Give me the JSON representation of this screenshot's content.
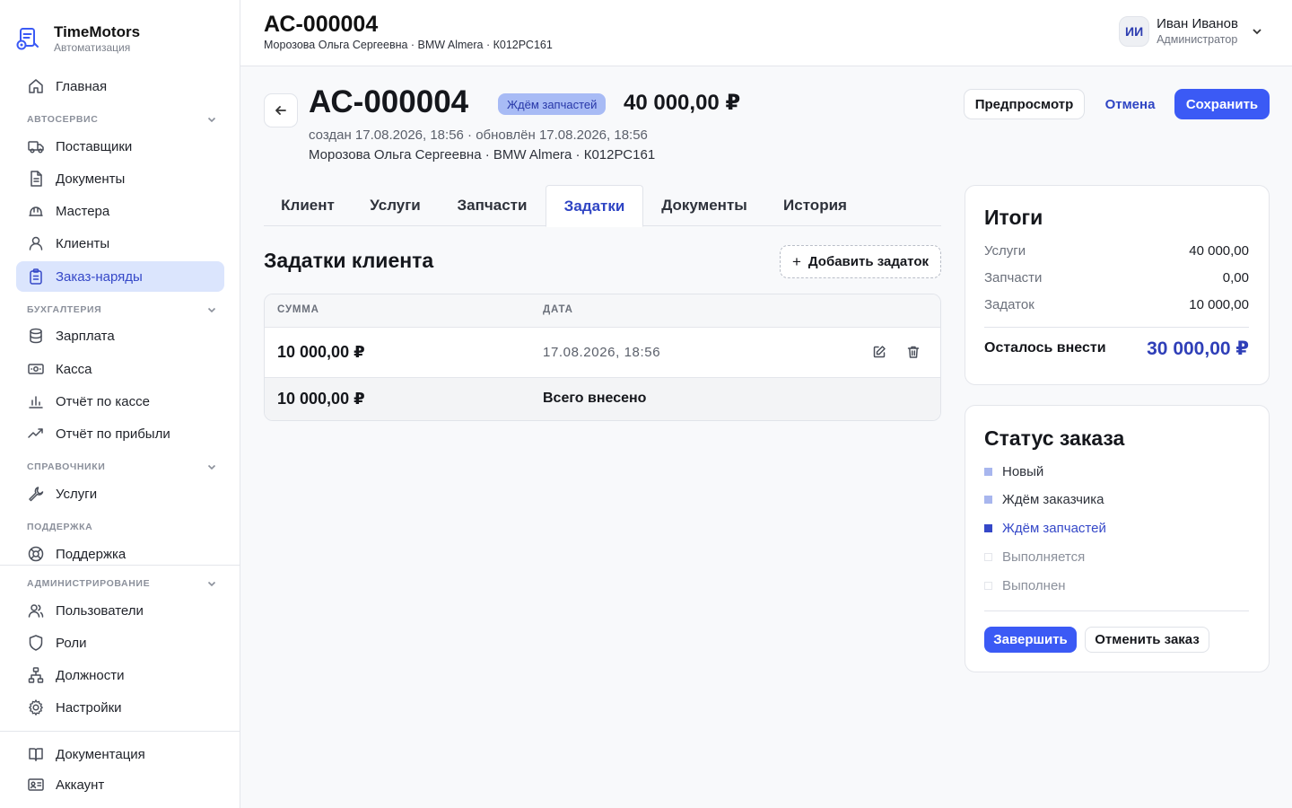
{
  "brand": {
    "name": "TimeMotors",
    "subtitle": "Автоматизация"
  },
  "sidebar": {
    "home": "Главная",
    "sections": {
      "autoservice": "АВТОСЕРВИС",
      "accounting": "БУХГАЛТЕРИЯ",
      "references": "СПРАВОЧНИКИ",
      "support": "ПОДДЕРЖКА",
      "administration": "АДМИНИСТРИРОВАНИЕ"
    },
    "items": {
      "suppliers": "Поставщики",
      "documents": "Документы",
      "masters": "Мастера",
      "clients": "Клиенты",
      "orders": "Заказ-наряды",
      "salary": "Зарплата",
      "cashbox": "Касса",
      "cash_report": "Отчёт по кассе",
      "profit_report": "Отчёт по прибыли",
      "services": "Услуги",
      "support": "Поддержка",
      "users": "Пользователи",
      "roles": "Роли",
      "positions": "Должности",
      "settings": "Настройки",
      "documentation": "Документация",
      "account": "Аккаунт"
    }
  },
  "header": {
    "title": "АС-000004",
    "subtitle": "Морозова Ольга Сергеевна · BMW Almera · К012РС161",
    "user": {
      "initials": "ИИ",
      "name": "Иван Иванов",
      "role": "Администратор"
    }
  },
  "order": {
    "number": "АС-000004",
    "status": "Ждём запчастей",
    "total": "40 000,00 ₽",
    "meta": "создан 17.08.2026, 18:56 · обновлён 17.08.2026, 18:56",
    "client_line": "Морозова Ольга Сергеевна · BMW Almera · К012РС161"
  },
  "actions": {
    "preview": "Предпросмотр",
    "cancel": "Отмена",
    "save": "Сохранить"
  },
  "tabs": [
    "Клиент",
    "Услуги",
    "Запчасти",
    "Задатки",
    "Документы",
    "История"
  ],
  "deposits": {
    "title": "Задатки клиента",
    "add_button": "Добавить задаток",
    "columns": [
      "СУММА",
      "ДАТА"
    ],
    "rows": [
      {
        "amount": "10 000,00 ₽",
        "date": "17.08.2026, 18:56"
      }
    ],
    "footer": {
      "amount": "10 000,00 ₽",
      "label": "Всего внесено"
    }
  },
  "summary": {
    "title": "Итоги",
    "rows": [
      {
        "label": "Услуги",
        "value": "40 000,00"
      },
      {
        "label": "Запчасти",
        "value": "0,00"
      },
      {
        "label": "Задаток",
        "value": "10 000,00"
      }
    ],
    "remaining_label": "Осталось внести",
    "remaining_value": "30 000,00 ₽"
  },
  "order_status": {
    "title": "Статус заказа",
    "steps": [
      "Новый",
      "Ждём заказчика",
      "Ждём запчастей",
      "Выполняется",
      "Выполнен"
    ],
    "finish_button": "Завершить",
    "cancel_button": "Отменить заказ"
  },
  "colors": {
    "accent": "#3b5af5",
    "accent_dark": "#2f45c4",
    "status_badge": "#a8bbf5",
    "active_nav": "#dbe5fd"
  }
}
